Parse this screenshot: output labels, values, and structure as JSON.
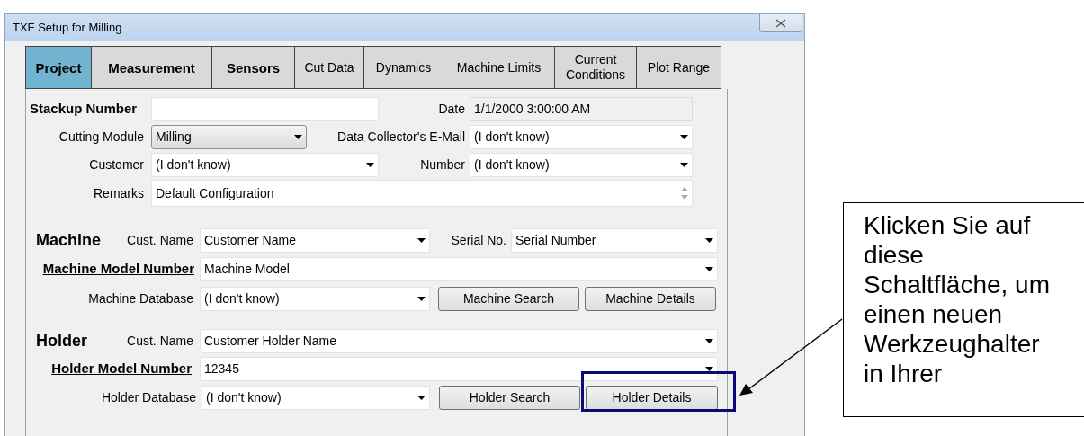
{
  "window": {
    "title": "TXF Setup for Milling"
  },
  "tabs": [
    {
      "label": "Project",
      "selected": true,
      "bold": true
    },
    {
      "label": "Measurement",
      "selected": false,
      "bold": true
    },
    {
      "label": "Sensors",
      "selected": false,
      "bold": true
    },
    {
      "label": "Cut Data",
      "selected": false,
      "bold": false
    },
    {
      "label": "Dynamics",
      "selected": false,
      "bold": false
    },
    {
      "label": "Machine Limits",
      "selected": false,
      "bold": false
    },
    {
      "label": "Current Conditions",
      "selected": false,
      "bold": false
    },
    {
      "label": "Plot Range",
      "selected": false,
      "bold": false
    }
  ],
  "form_rows": [
    [
      {
        "kind": "bold_label",
        "text": "Stackup Number"
      },
      {
        "kind": "text"
      },
      {
        "kind": "label",
        "text": "Date"
      },
      {
        "kind": "readonly",
        "value": "1/1/2000 3:00:00 AM"
      }
    ],
    [
      {
        "kind": "label",
        "text": "Cutting Module"
      },
      {
        "kind": "combo",
        "value": "Milling"
      },
      {
        "kind": "label",
        "text": "Data Collector's E-Mail"
      },
      {
        "kind": "dropdown",
        "value": "(I don't know)"
      }
    ],
    [
      {
        "kind": "label",
        "text": "Customer"
      },
      {
        "kind": "dropdown",
        "value": "(I don't know)"
      },
      {
        "kind": "label",
        "text": "Number"
      },
      {
        "kind": "dropdown",
        "value": "(I don't know)"
      }
    ],
    [
      {
        "kind": "label",
        "text": "Remarks"
      },
      {
        "kind": "memo",
        "value": "Default Configuration"
      }
    ],
    [
      {
        "kind": "heading",
        "text": "Machine"
      },
      {
        "kind": "label",
        "text": "Cust. Name"
      },
      {
        "kind": "dropdown",
        "value": "Customer Name"
      },
      {
        "kind": "label",
        "text": "Serial No."
      },
      {
        "kind": "dropdown",
        "value": "Serial Number"
      }
    ],
    [
      {
        "kind": "link_label",
        "text": "Machine Model Number"
      },
      {
        "kind": "dropdown",
        "value": "Machine Model"
      }
    ],
    [
      {
        "kind": "label",
        "text": "Machine Database"
      },
      {
        "kind": "dropdown",
        "value": "(I don't know)"
      },
      {
        "kind": "button",
        "text": "Machine Search",
        "highlighted": false
      },
      {
        "kind": "button",
        "text": "Machine Details",
        "highlighted": false
      }
    ],
    [
      {
        "kind": "heading",
        "text": "Holder"
      },
      {
        "kind": "label",
        "text": "Cust. Name"
      },
      {
        "kind": "dropdown",
        "value": "Customer Holder Name"
      }
    ],
    [
      {
        "kind": "link_label",
        "text": "Holder Model Number"
      },
      {
        "kind": "dropdown",
        "value": "12345"
      }
    ],
    [
      {
        "kind": "label",
        "text": "Holder Database"
      },
      {
        "kind": "dropdown",
        "value": "(I don't know)"
      },
      {
        "kind": "button",
        "text": "Holder Search",
        "highlighted": false
      },
      {
        "kind": "button",
        "text": "Holder Details",
        "highlighted": true
      }
    ]
  ],
  "callout": {
    "text": "Klicken Sie auf diese Schaltfläche, um einen neuen Werkzeughalter in Ihrer"
  }
}
